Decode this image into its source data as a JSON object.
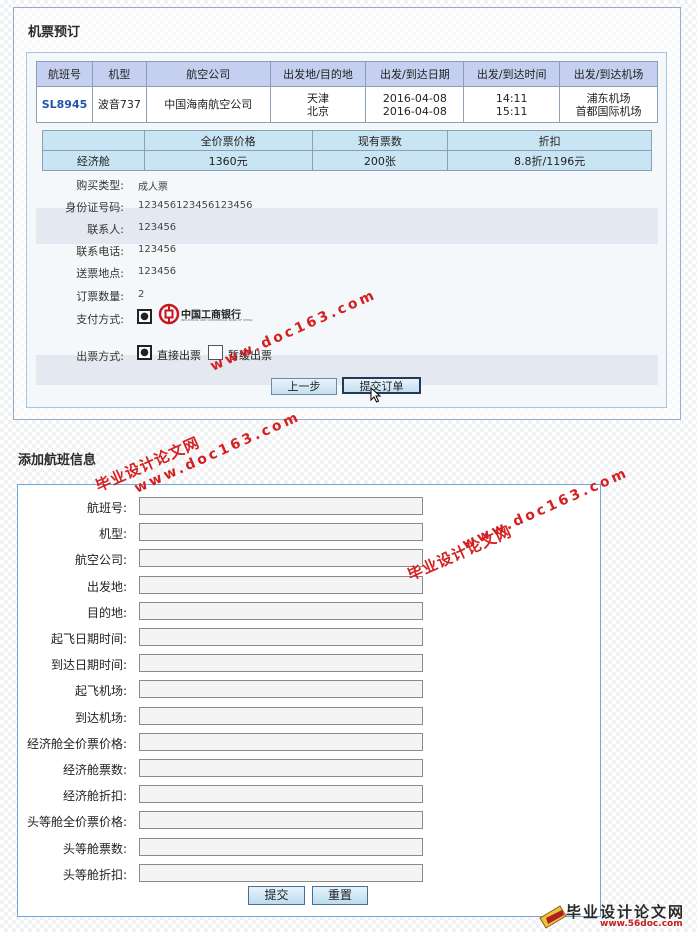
{
  "booking": {
    "title": "机票预订",
    "flight_headers": [
      "航班号",
      "机型",
      "航空公司",
      "出发地/目的地",
      "出发/到达日期",
      "出发/到达时间",
      "出发/到达机场"
    ],
    "flight_row": {
      "flight_no": "SL8945",
      "model": "波音737",
      "airline": "中国海南航空公司",
      "origin": "天津",
      "destination": "北京",
      "depart_date": "2016-04-08",
      "arrive_date": "2016-04-08",
      "depart_time": "14:11",
      "arrive_time": "15:11",
      "depart_airport": "浦东机场",
      "arrive_airport": "首都国际机场"
    },
    "price_headers": [
      "",
      "全价票价格",
      "现有票数",
      "折扣"
    ],
    "price_row": {
      "cabin": "经济舱",
      "full_price": "1360元",
      "tickets": "200张",
      "discount": "8.8折/1196元"
    },
    "form": {
      "purchase_type_label": "购买类型:",
      "purchase_type_value": "成人票",
      "id_label": "身份证号码:",
      "id_value": "123456123456123456",
      "contact_label": "联系人:",
      "contact_value": "123456",
      "phone_label": "联系电话:",
      "phone_value": "123456",
      "delivery_label": "送票地点:",
      "delivery_value": "123456",
      "quantity_label": "订票数量:",
      "quantity_value": "2",
      "payment_label": "支付方式:",
      "bank_name": "中国工商银行",
      "bank_subtitle": "INDUSTRIAL AND COMMERCIAL BANK OF CHINA",
      "issue_label": "出票方式:",
      "issue_direct": "直接出票",
      "issue_hold": "暂缓出票"
    },
    "buttons": {
      "prev": "上一步",
      "submit": "提交订单"
    }
  },
  "add_flight": {
    "title": "添加航班信息",
    "fields": [
      "航班号:",
      "机型:",
      "航空公司:",
      "出发地:",
      "目的地:",
      "起飞日期时间:",
      "到达日期时间:",
      "起飞机场:",
      "到达机场:",
      "经济舱全价票价格:",
      "经济舱票数:",
      "经济舱折扣:",
      "头等舱全价票价格:",
      "头等舱票数:",
      "头等舱折扣:"
    ],
    "buttons": {
      "submit": "提交",
      "reset": "重置"
    }
  },
  "watermarks": {
    "site_cn": "毕业设计论文网",
    "site_url": "www.doc163.com",
    "footer_cn": "毕业设计论文网",
    "footer_url": "www.56doc.com"
  },
  "colors": {
    "header_blue": "#c5cff0",
    "price_row_blue": "#c9e4f3",
    "panel_border": "#6fa6d6",
    "watermark_red": "#d42020"
  }
}
